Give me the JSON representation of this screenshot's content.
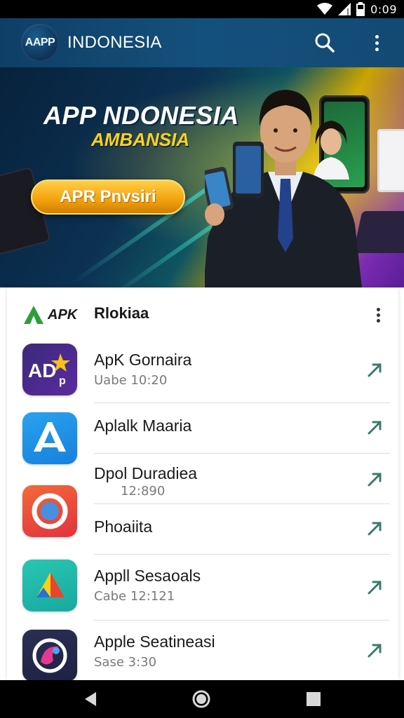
{
  "status_bar": {
    "time": "0:09"
  },
  "app_bar": {
    "logo_text": "AAPP",
    "title": "INDONESIA"
  },
  "banner": {
    "title": "APP NDONESIA",
    "subtitle": "AMBANSIA",
    "cta_label": "APR Pnvsiri"
  },
  "list": {
    "logo_text": "APK",
    "title": "Rlokiaa",
    "items": [
      {
        "name": "ApK Gornaira",
        "sub": "Uabe 10:20",
        "icon": "ad-icon"
      },
      {
        "name": "Aplalk Maaria",
        "sub": "",
        "icon": "a-letter-icon"
      },
      {
        "name": "Dpol Duradiea",
        "sub": "12:890",
        "icon": "circle-icon"
      },
      {
        "name": "Phoaiita",
        "sub": "",
        "icon": ""
      },
      {
        "name": "Appll Sesaoals",
        "sub": "Cabe 12:121",
        "icon": "triangle-icon"
      },
      {
        "name": "Apple Seatineasi",
        "sub": "Sase 3:30",
        "icon": "swirl-icon"
      }
    ]
  },
  "colors": {
    "app_bar": "#14507c",
    "accent_gold": "#ffd21f",
    "chevron": "#3c7a6e"
  }
}
